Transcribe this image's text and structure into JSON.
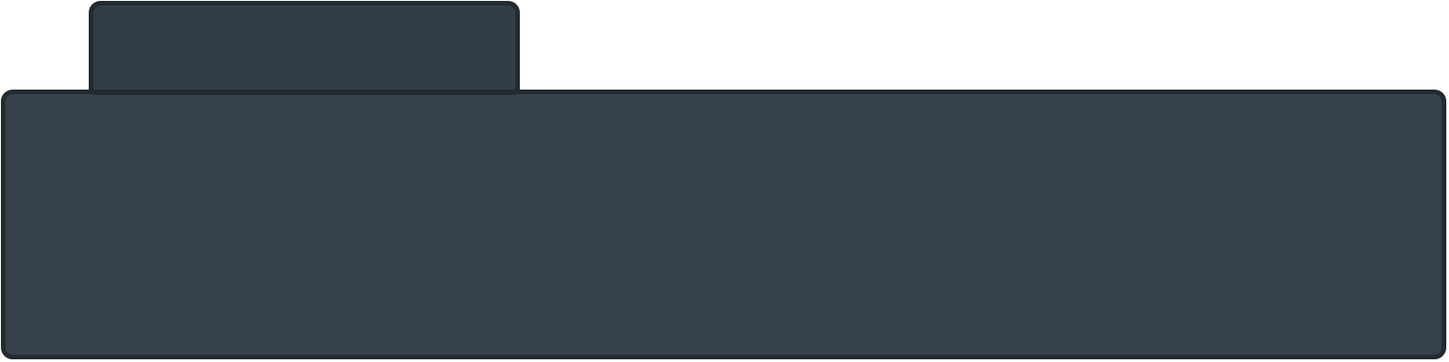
{
  "colors": {
    "tab_fill": "#333d48",
    "panel_fill": "#37414c",
    "border": "#232b31",
    "background": "#ffffff"
  },
  "tab": {
    "label": ""
  },
  "panel": {
    "content": ""
  }
}
